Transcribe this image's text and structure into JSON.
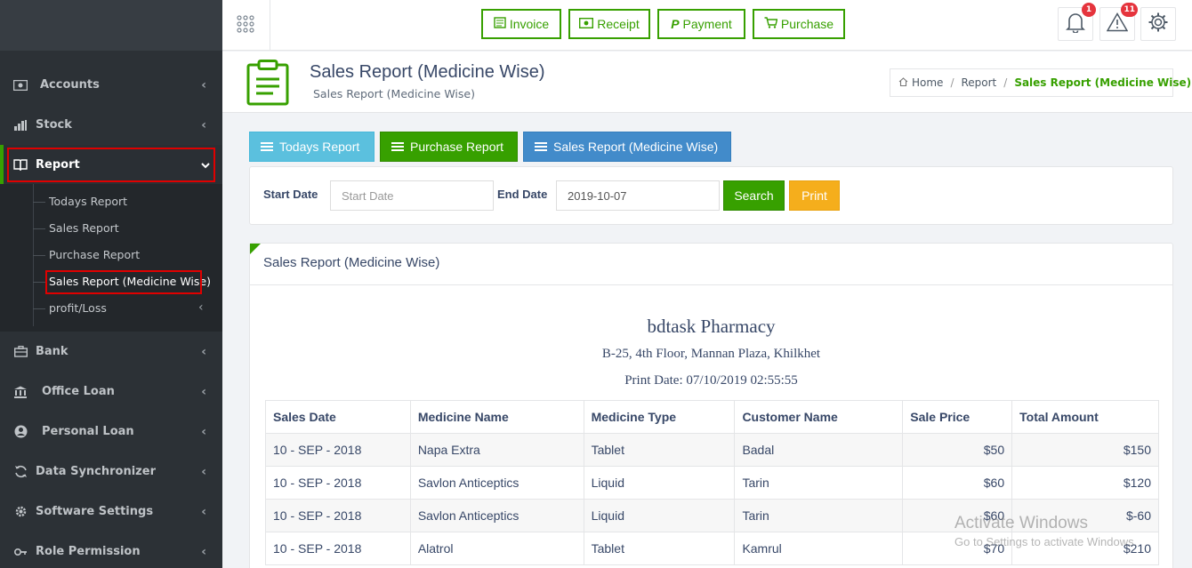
{
  "sidebar": {
    "items": [
      {
        "label": "Accounts",
        "icon": "money-icon"
      },
      {
        "label": "Stock",
        "icon": "bar-chart-icon"
      },
      {
        "label": "Report",
        "icon": "book-icon"
      },
      {
        "label": "Bank",
        "icon": "briefcase-icon"
      },
      {
        "label": "Office Loan",
        "icon": "bank-icon"
      },
      {
        "label": "Personal Loan",
        "icon": "user-circle-icon"
      },
      {
        "label": "Data Synchronizer",
        "icon": "sync-icon"
      },
      {
        "label": "Software Settings",
        "icon": "gear-icon"
      },
      {
        "label": "Role Permission",
        "icon": "key-icon"
      }
    ],
    "report_submenu": [
      {
        "label": "Todays Report"
      },
      {
        "label": "Sales Report"
      },
      {
        "label": "Purchase Report"
      },
      {
        "label": "Sales Report (Medicine Wise)"
      },
      {
        "label": "profit/Loss"
      }
    ]
  },
  "topbar": {
    "buttons": [
      {
        "label": "Invoice"
      },
      {
        "label": "Receipt"
      },
      {
        "label": "Payment"
      },
      {
        "label": "Purchase"
      }
    ],
    "notifications_count": "1",
    "alerts_count": "11",
    "accent": "#37a000"
  },
  "header": {
    "title": "Sales Report (Medicine Wise)",
    "subtitle": "Sales Report (Medicine Wise)",
    "breadcrumb": [
      "Home",
      "Report",
      "Sales Report (Medicine Wise)"
    ]
  },
  "tabs": [
    {
      "label": "Todays Report",
      "color": "#5bc0de"
    },
    {
      "label": "Purchase Report",
      "color": "#37a000"
    },
    {
      "label": "Sales Report (Medicine Wise)",
      "color": "#428bca"
    }
  ],
  "filter": {
    "start_label": "Start Date",
    "start_placeholder": "Start Date",
    "end_label": "End Date",
    "end_value": "2019-10-07",
    "search_label": "Search",
    "print_label": "Print"
  },
  "report": {
    "panel_title": "Sales Report (Medicine Wise)",
    "shop_name": "bdtask Pharmacy",
    "address": "B-25, 4th Floor, Mannan Plaza, Khilkhet",
    "print_date": "Print Date: 07/10/2019 02:55:55",
    "columns": [
      "Sales Date",
      "Medicine Name",
      "Medicine Type",
      "Customer Name",
      "Sale Price",
      "Total Amount"
    ],
    "rows": [
      [
        "10 - SEP - 2018",
        "Napa Extra",
        "Tablet",
        "Badal",
        "$50",
        "$150"
      ],
      [
        "10 - SEP - 2018",
        "Savlon Anticeptics",
        "Liquid",
        "Tarin",
        "$60",
        "$120"
      ],
      [
        "10 - SEP - 2018",
        "Savlon Anticeptics",
        "Liquid",
        "Tarin",
        "$60",
        "$-60"
      ],
      [
        "10 - SEP - 2018",
        "Alatrol",
        "Tablet",
        "Kamrul",
        "$70",
        "$210"
      ]
    ]
  },
  "watermark": {
    "line1": "Activate Windows",
    "line2": "Go to Settings to activate Windows."
  }
}
